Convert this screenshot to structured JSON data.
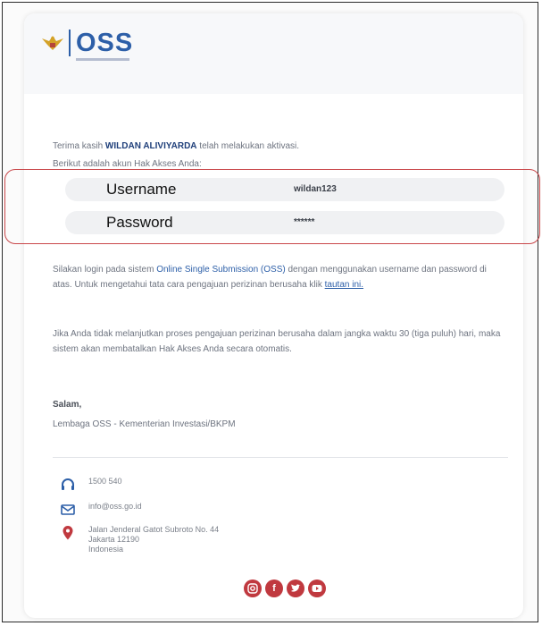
{
  "brand": {
    "name": "OSS"
  },
  "message": {
    "thanks_prefix": "Terima kasih",
    "user_name": "WILDAN ALIVIYARDA",
    "thanks_suffix": "telah melakukan aktivasi.",
    "intro": "Berikut adalah akun Hak Akses Anda:"
  },
  "credentials": {
    "username_label": "Username",
    "username_value": "wildan123",
    "password_label": "Password",
    "password_value": "******"
  },
  "body": {
    "para1_a": "Silakan login pada sistem",
    "para1_link1": "Online Single Submission (OSS)",
    "para1_b": "dengan menggunakan username dan password di atas. Untuk mengetahui tata cara pengajuan perizinan berusaha klik",
    "para1_link2": "tautan ini.",
    "para2": "Jika Anda tidak melanjutkan proses pengajuan perizinan berusaha dalam jangka waktu 30 (tiga puluh) hari, maka sistem akan membatalkan Hak Akses Anda secara otomatis.",
    "salam": "Salam,",
    "signature": "Lembaga OSS - Kementerian Investasi/BKPM"
  },
  "contact": {
    "phone": "1500 540",
    "email": "info@oss.go.id",
    "address_line1": "Jalan Jenderal Gatot Subroto No. 44",
    "address_line2": "Jakarta 12190",
    "address_line3": "Indonesia"
  },
  "colors": {
    "brand_blue": "#2d5fa8",
    "highlight_red": "#c9474a",
    "social_red": "#c0393f"
  },
  "social_icons": [
    "instagram-icon",
    "facebook-icon",
    "twitter-icon",
    "youtube-icon"
  ]
}
